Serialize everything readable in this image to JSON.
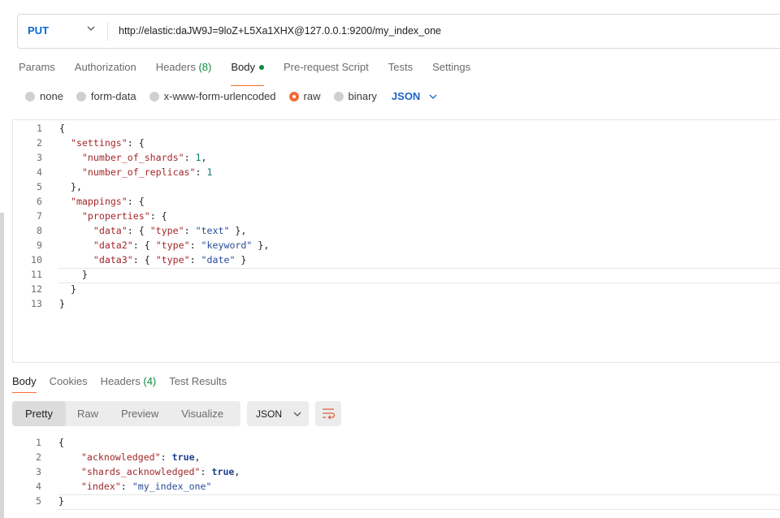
{
  "request": {
    "method": "PUT",
    "url": "http://elastic:daJW9J=9loZ+L5Xa1XHX@127.0.0.1:9200/my_index_one"
  },
  "request_tabs": [
    {
      "label": "Params"
    },
    {
      "label": "Authorization"
    },
    {
      "label": "Headers",
      "count": "(8)"
    },
    {
      "label": "Body"
    },
    {
      "label": "Pre-request Script"
    },
    {
      "label": "Tests"
    },
    {
      "label": "Settings"
    }
  ],
  "body_types": [
    "none",
    "form-data",
    "x-www-form-urlencoded",
    "raw",
    "binary"
  ],
  "body_type_selected": "raw",
  "body_format": "JSON",
  "request_body": {
    "line_numbers": [
      "1",
      "2",
      "3",
      "4",
      "5",
      "6",
      "7",
      "8",
      "9",
      "10",
      "11",
      "12",
      "13"
    ],
    "lines": [
      "{",
      "  \"settings\": {",
      "    \"number_of_shards\": 1,",
      "    \"number_of_replicas\": 1",
      "  },",
      "  \"mappings\": {",
      "    \"properties\": {",
      "      \"data\": { \"type\": \"text\" },",
      "      \"data2\": { \"type\": \"keyword\" },",
      "      \"data3\": { \"type\": \"date\" }",
      "    }",
      "  }",
      "}"
    ]
  },
  "response_tabs": [
    {
      "label": "Body"
    },
    {
      "label": "Cookies"
    },
    {
      "label": "Headers",
      "count": "(4)"
    },
    {
      "label": "Test Results"
    }
  ],
  "response_views": [
    "Pretty",
    "Raw",
    "Preview",
    "Visualize"
  ],
  "response_format": "JSON",
  "response_body": {
    "line_numbers": [
      "1",
      "2",
      "3",
      "4",
      "5"
    ],
    "lines": [
      "{",
      "    \"acknowledged\": true,",
      "    \"shards_acknowledged\": true,",
      "    \"index\": \"my_index_one\"",
      "}"
    ]
  },
  "colors": {
    "accent": "#ff6c37",
    "method": "#0b6ad2",
    "json_key": "#a3272a",
    "json_string": "#2a4c9a",
    "json_number": "#0d7a6a",
    "status_dot": "#0d8a3e"
  }
}
